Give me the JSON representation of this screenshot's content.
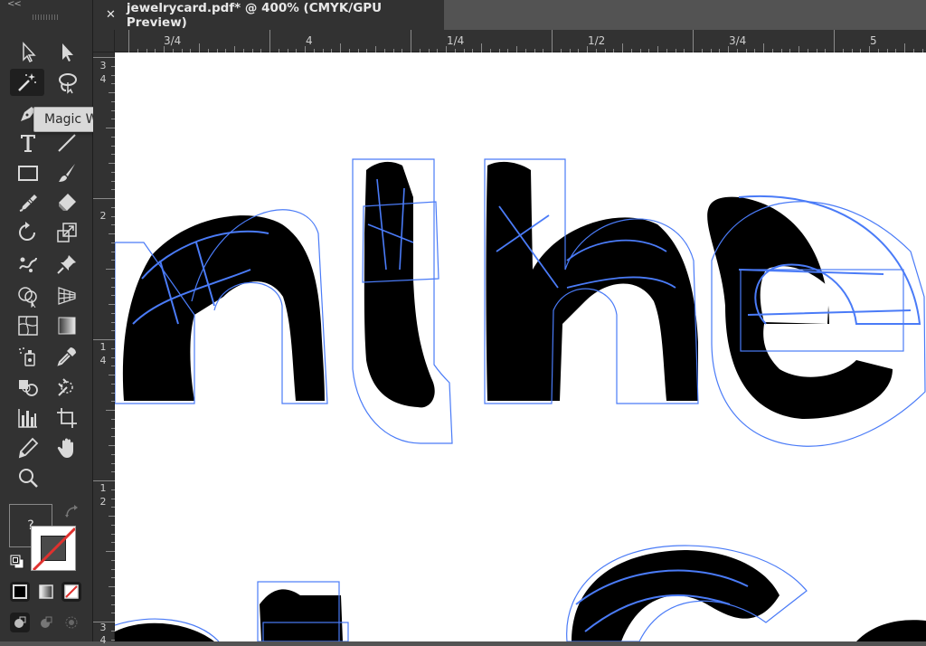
{
  "document_tab": {
    "title": "jewelrycard.pdf* @ 400% (CMYK/GPU Preview)",
    "close_symbol": "✕"
  },
  "toolbar": {
    "collapse_symbol": "<<",
    "tooltip": "Magic Wand Tool (Y)",
    "active_tool": "magic-wand-tool",
    "fill_label": "?",
    "tools": [
      "direct-selection-tool",
      "selection-tool",
      "magic-wand-tool",
      "lasso-tool",
      "pen-tool",
      "curvature-tool",
      "type-tool",
      "line-segment-tool",
      "rectangle-tool",
      "paintbrush-tool",
      "blob-brush-tool",
      "eraser-tool",
      "rotate-tool",
      "scale-tool",
      "puppet-warp-tool",
      "pin-tool",
      "shape-builder-tool",
      "perspective-grid-tool",
      "mesh-tool",
      "gradient-tool",
      "symbol-sprayer-tool",
      "eyedropper-tool",
      "blend-tool",
      "slice-tool",
      "column-graph-tool",
      "artboard-tool",
      "pencil-tool",
      "hand-tool",
      "zoom-tool"
    ]
  },
  "rulers": {
    "horizontal": [
      "3/4",
      "4",
      "1/4",
      "1/2",
      "3/4",
      "5"
    ],
    "vertical": [
      {
        "top": "3",
        "bottom": "4"
      },
      {
        "top": "2",
        "bottom": ""
      },
      {
        "top": "1",
        "bottom": "4"
      },
      {
        "top": "1",
        "bottom": "2"
      },
      {
        "top": "3",
        "bottom": "4"
      }
    ]
  },
  "canvas": {
    "fill_color": "#000000",
    "selection_color": "#4a7bf7",
    "background": "#ffffff"
  }
}
